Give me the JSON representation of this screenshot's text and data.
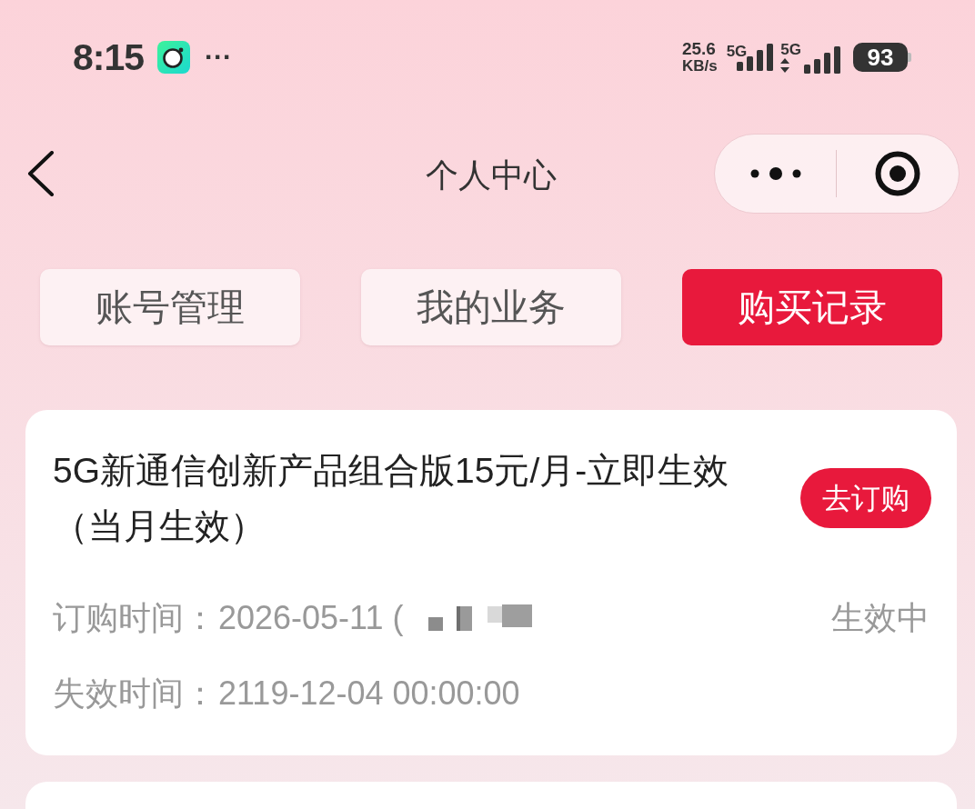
{
  "status_bar": {
    "time": "8:15",
    "more": "···",
    "speed_value": "25.6",
    "speed_unit": "KB/s",
    "networks": [
      {
        "label": "5G",
        "data_active": false
      },
      {
        "label": "5G",
        "data_active": true
      }
    ],
    "battery": "93"
  },
  "nav_bar": {
    "title": "个人中心"
  },
  "tabs": [
    {
      "label": "账号管理",
      "selected": false
    },
    {
      "label": "我的业务",
      "selected": false
    },
    {
      "label": "购买记录",
      "selected": true
    }
  ],
  "records": [
    {
      "title": "5G新通信创新产品组合版15元/月-立即生效（当月生效）",
      "action": "去订购",
      "status": "生效中",
      "fields": [
        {
          "label": "订购时间：",
          "value": "2026-05-11 (",
          "obscured": true
        },
        {
          "label": "失效时间：",
          "value": "2119-12-04 00:00:00",
          "obscured": false
        }
      ]
    }
  ]
}
